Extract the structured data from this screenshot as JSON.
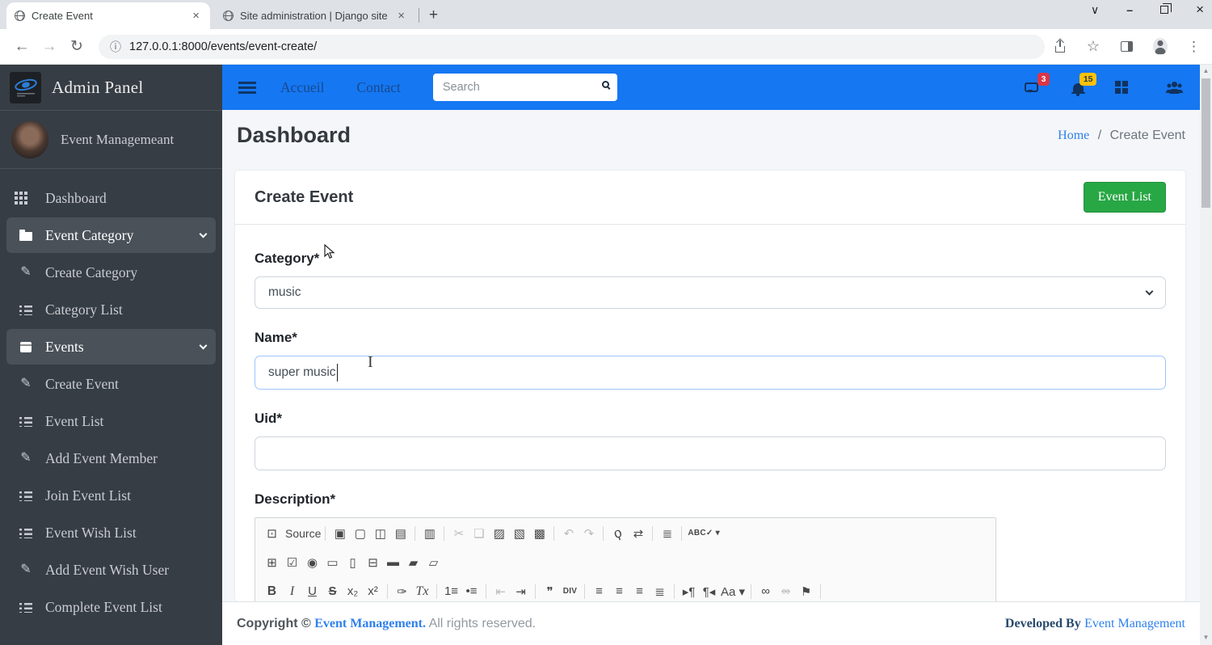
{
  "browser": {
    "tab1": "Create Event",
    "tab2": "Site administration | Django site",
    "url": "127.0.0.1:8000/events/event-create/"
  },
  "sidebar": {
    "brand": "Admin Panel",
    "user_name": "Event Managemeant",
    "items": [
      {
        "label": "Dashboard",
        "icon": "grid",
        "active": false,
        "chevron": false
      },
      {
        "label": "Event Category",
        "icon": "folder",
        "active": true,
        "chevron": true
      },
      {
        "label": "Create Category",
        "icon": "edit",
        "active": false,
        "chevron": false
      },
      {
        "label": "Category List",
        "icon": "list",
        "active": false,
        "chevron": false
      },
      {
        "label": "Events",
        "icon": "calendar",
        "active": true,
        "chevron": true
      },
      {
        "label": "Create Event",
        "icon": "edit",
        "active": false,
        "chevron": false
      },
      {
        "label": "Event List",
        "icon": "list",
        "active": false,
        "chevron": false
      },
      {
        "label": "Add Event Member",
        "icon": "edit",
        "active": false,
        "chevron": false
      },
      {
        "label": "Join Event List",
        "icon": "list",
        "active": false,
        "chevron": false
      },
      {
        "label": "Event Wish List",
        "icon": "list",
        "active": false,
        "chevron": false
      },
      {
        "label": "Add Event Wish User",
        "icon": "edit",
        "active": false,
        "chevron": false
      },
      {
        "label": "Complete Event List",
        "icon": "list",
        "active": false,
        "chevron": false
      }
    ]
  },
  "navbar": {
    "link_accueil": "Accueil",
    "link_contact": "Contact",
    "search_placeholder": "Search",
    "messages_badge": "3",
    "notifications_badge": "15"
  },
  "page": {
    "title": "Dashboard",
    "breadcrumb_home": "Home",
    "breadcrumb_sep": "/",
    "breadcrumb_current": "Create Event"
  },
  "card": {
    "title": "Create Event",
    "event_list_button": "Event List",
    "category_label": "Category*",
    "category_value": "music",
    "name_label": "Name*",
    "name_value": "super music",
    "uid_label": "Uid*",
    "uid_value": "",
    "description_label": "Description*"
  },
  "editor": {
    "rows": [
      [
        {
          "n": "source-button",
          "g": "⊡",
          "t": "Source"
        },
        "|",
        {
          "n": "save-icon",
          "g": "▣"
        },
        {
          "n": "new-page-icon",
          "g": "▢"
        },
        {
          "n": "preview-icon",
          "g": "◫"
        },
        {
          "n": "print-icon",
          "g": "▤"
        },
        "|",
        {
          "n": "templates-icon",
          "g": "▥"
        },
        "|",
        {
          "n": "cut-icon",
          "g": "✂",
          "d": true
        },
        {
          "n": "copy-icon",
          "g": "❏",
          "d": true
        },
        {
          "n": "paste-icon",
          "g": "▨"
        },
        {
          "n": "paste-text-icon",
          "g": "▧"
        },
        {
          "n": "paste-word-icon",
          "g": "▩"
        },
        "|",
        {
          "n": "undo-icon",
          "g": "↶",
          "d": true
        },
        {
          "n": "redo-icon",
          "g": "↷",
          "d": true
        },
        "|",
        {
          "n": "find-icon",
          "g": "ϙ",
          "c": "rot"
        },
        {
          "n": "replace-icon",
          "g": "⇄"
        },
        "|",
        {
          "n": "select-all-icon",
          "g": "≣"
        },
        "|",
        {
          "n": "spellcheck-icon",
          "g": "ABC✓ ▾",
          "c": "small"
        }
      ],
      [
        {
          "n": "form-icon",
          "g": "⊞"
        },
        {
          "n": "checkbox-icon",
          "g": "☑"
        },
        {
          "n": "radio-icon",
          "g": "◉"
        },
        {
          "n": "text-field-icon",
          "g": "▭"
        },
        {
          "n": "textarea-icon",
          "g": "▯"
        },
        {
          "n": "select-field-icon",
          "g": "⊟"
        },
        {
          "n": "button-icon",
          "g": "▬"
        },
        {
          "n": "image-button-icon",
          "g": "▰"
        },
        {
          "n": "hidden-field-icon",
          "g": "▱"
        }
      ],
      [
        {
          "n": "bold-button",
          "g": "B",
          "c": "bold"
        },
        {
          "n": "italic-button",
          "g": "I",
          "c": "ital"
        },
        {
          "n": "underline-button",
          "g": "U",
          "c": "und"
        },
        {
          "n": "strikethrough-button",
          "g": "S",
          "c": "strk"
        },
        {
          "n": "subscript-button",
          "g": "x₂"
        },
        {
          "n": "superscript-button",
          "g": "x²"
        },
        "|",
        {
          "n": "copy-formatting-button",
          "g": "✑"
        },
        {
          "n": "remove-format-button",
          "g": "Tx",
          "c": "ital"
        },
        "|",
        {
          "n": "numbered-list-button",
          "g": "1≡"
        },
        {
          "n": "bulleted-list-button",
          "g": "•≡"
        },
        "|",
        {
          "n": "decrease-indent-button",
          "g": "⇤",
          "d": true
        },
        {
          "n": "increase-indent-button",
          "g": "⇥"
        },
        "|",
        {
          "n": "blockquote-button",
          "g": "❞"
        },
        {
          "n": "div-container-button",
          "g": "DIV",
          "c": "small"
        },
        "|",
        {
          "n": "align-left-button",
          "g": "≡"
        },
        {
          "n": "align-center-button",
          "g": "≡"
        },
        {
          "n": "align-right-button",
          "g": "≡"
        },
        {
          "n": "align-justify-button",
          "g": "≣"
        },
        "|",
        {
          "n": "text-direction-ltr-button",
          "g": "▸¶"
        },
        {
          "n": "text-direction-rtl-button",
          "g": "¶◂"
        },
        {
          "n": "language-button",
          "g": "Aa ▾"
        },
        "|",
        {
          "n": "link-button",
          "g": "∞"
        },
        {
          "n": "unlink-button",
          "g": "∞",
          "d": true,
          "c": "strike"
        },
        {
          "n": "anchor-button",
          "g": "⚑"
        },
        "|"
      ]
    ]
  },
  "footer": {
    "copyright_bold": "Copyright ©",
    "copyright_link": "Event Management.",
    "rights": "All rights reserved.",
    "developed_by": "Developed By",
    "developed_link": "Event Management"
  },
  "colors": {
    "navbar_blue": "#1577f2",
    "sidebar_dark": "#373d44",
    "button_green": "#28a745",
    "badge_red": "#dc3545",
    "badge_yellow": "#ffc107",
    "link_blue": "#2f80ed"
  }
}
